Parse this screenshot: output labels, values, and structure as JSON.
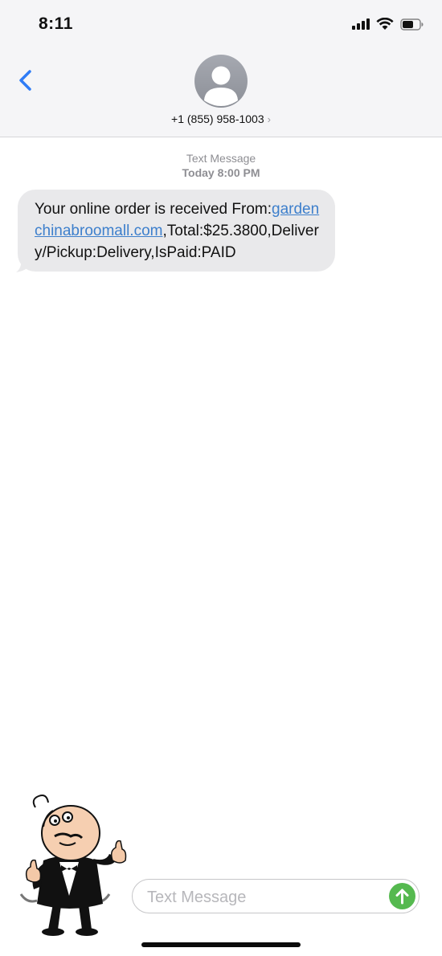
{
  "status_bar": {
    "time": "8:11",
    "icons": [
      "cellular-signal-icon",
      "wifi-icon",
      "battery-icon"
    ]
  },
  "header": {
    "back_icon": "chevron-left-icon",
    "avatar_icon": "person-avatar-icon",
    "contact_number": "+1 (855) 958-1003",
    "contact_chevron": "›"
  },
  "conversation": {
    "service_label": "Text Message",
    "timestamp": "Today 8:00 PM",
    "messages": [
      {
        "direction": "incoming",
        "text_before_link": "Your online order is received From:",
        "link_text": "gardenchinabroomall.com",
        "text_after_link": ",Total:$25.3800,Delivery/Pickup:Delivery,IsPaid:PAID"
      }
    ]
  },
  "compose": {
    "placeholder": "Text Message",
    "value": "",
    "send_icon": "send-arrow-up-icon"
  },
  "colors": {
    "header_bg": "#f5f5f7",
    "bubble_incoming": "#e9e9eb",
    "link": "#3d7fcc",
    "send_button": "#55b94f",
    "ios_blue": "#2f7cf6"
  }
}
